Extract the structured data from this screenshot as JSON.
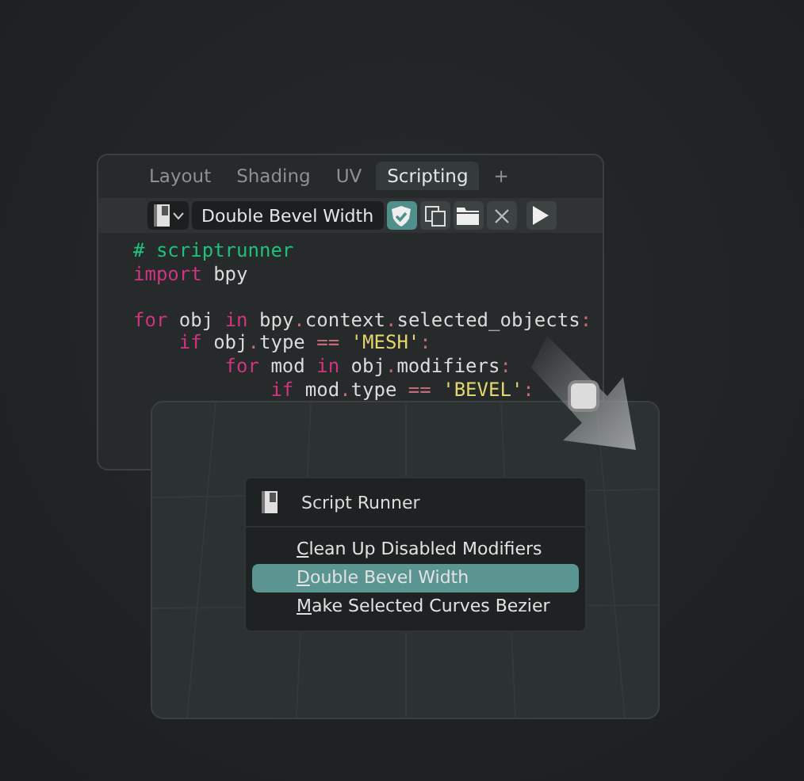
{
  "tabs": [
    {
      "label": "Layout",
      "selected": false
    },
    {
      "label": "Shading",
      "selected": false
    },
    {
      "label": "UV",
      "selected": false
    },
    {
      "label": "Scripting",
      "selected": true
    },
    {
      "label": "+",
      "selected": false
    }
  ],
  "toolbar": {
    "script_name": "Double Bevel Width",
    "fake_user": true
  },
  "code": [
    [
      {
        "kind": "comment",
        "text": "# scriptrunner"
      }
    ],
    [
      {
        "kind": "keyword",
        "text": "import"
      },
      {
        "kind": "name",
        "text": " bpy"
      }
    ],
    {
      "kind": "blank"
    },
    [
      {
        "kind": "keyword",
        "text": "for"
      },
      {
        "kind": "name",
        "text": " obj "
      },
      {
        "kind": "keyword",
        "text": "in"
      },
      {
        "kind": "name",
        "text": " bpy"
      },
      {
        "kind": "op",
        "text": "."
      },
      {
        "kind": "name",
        "text": "context"
      },
      {
        "kind": "op",
        "text": "."
      },
      {
        "kind": "name",
        "text": "selected_objects"
      },
      {
        "kind": "op",
        "text": ":"
      }
    ],
    [
      {
        "kind": "keyword",
        "text": "    if"
      },
      {
        "kind": "name",
        "text": " obj"
      },
      {
        "kind": "op",
        "text": "."
      },
      {
        "kind": "name",
        "text": "type "
      },
      {
        "kind": "op",
        "text": "=="
      },
      {
        "kind": "string",
        "text": " 'MESH'"
      },
      {
        "kind": "op",
        "text": ":"
      }
    ],
    [
      {
        "kind": "keyword",
        "text": "        for"
      },
      {
        "kind": "name",
        "text": " mod "
      },
      {
        "kind": "keyword",
        "text": "in"
      },
      {
        "kind": "name",
        "text": " obj"
      },
      {
        "kind": "op",
        "text": "."
      },
      {
        "kind": "name",
        "text": "modifiers"
      },
      {
        "kind": "op",
        "text": ":"
      }
    ],
    [
      {
        "kind": "keyword",
        "text": "            if"
      },
      {
        "kind": "name",
        "text": " mod"
      },
      {
        "kind": "op",
        "text": "."
      },
      {
        "kind": "name",
        "text": "type "
      },
      {
        "kind": "op",
        "text": "=="
      },
      {
        "kind": "string",
        "text": " 'BEVEL'"
      },
      {
        "kind": "op",
        "text": ":"
      }
    ]
  ],
  "menu": {
    "title": "Script Runner",
    "items": [
      {
        "label": "Clean Up Disabled Modifiers",
        "selected": false
      },
      {
        "label": "Double Bevel Width",
        "selected": true
      },
      {
        "label": "Make Selected Curves Bezier",
        "selected": false
      }
    ]
  }
}
